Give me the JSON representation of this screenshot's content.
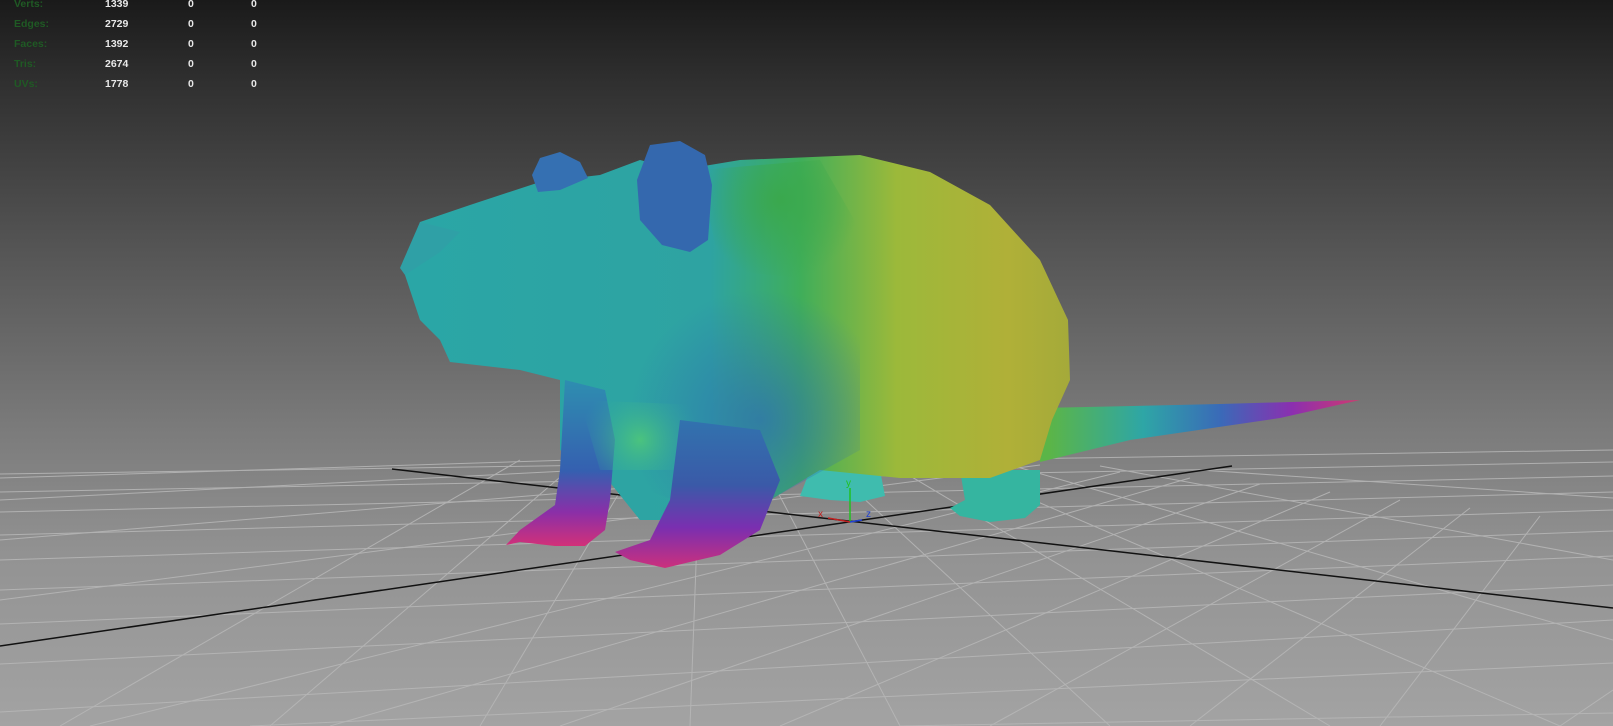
{
  "hud": {
    "rows": [
      {
        "label": "Verts:",
        "total": "1339",
        "selected": "0",
        "extra": "0"
      },
      {
        "label": "Edges:",
        "total": "2729",
        "selected": "0",
        "extra": "0"
      },
      {
        "label": "Faces:",
        "total": "1392",
        "selected": "0",
        "extra": "0"
      },
      {
        "label": "Tris:",
        "total": "2674",
        "selected": "0",
        "extra": "0"
      },
      {
        "label": "UVs:",
        "total": "1778",
        "selected": "0",
        "extra": "0"
      }
    ]
  },
  "axis_gizmo": {
    "x_label": "x",
    "y_label": "y",
    "z_label": "z",
    "x_color": "#c02020",
    "y_color": "#20c020",
    "z_color": "#2040d0"
  },
  "model": {
    "name_icon": "rat-model",
    "shading": "normal-map-vertex-colors"
  },
  "colors": {
    "background_top": "#1a1a1a",
    "background_bottom": "#a3a3a3",
    "grid_line": "#b8b8b8",
    "axis_line": "#111111",
    "hud_label": "#1f5a24",
    "hud_value": "#e8e8e8"
  }
}
